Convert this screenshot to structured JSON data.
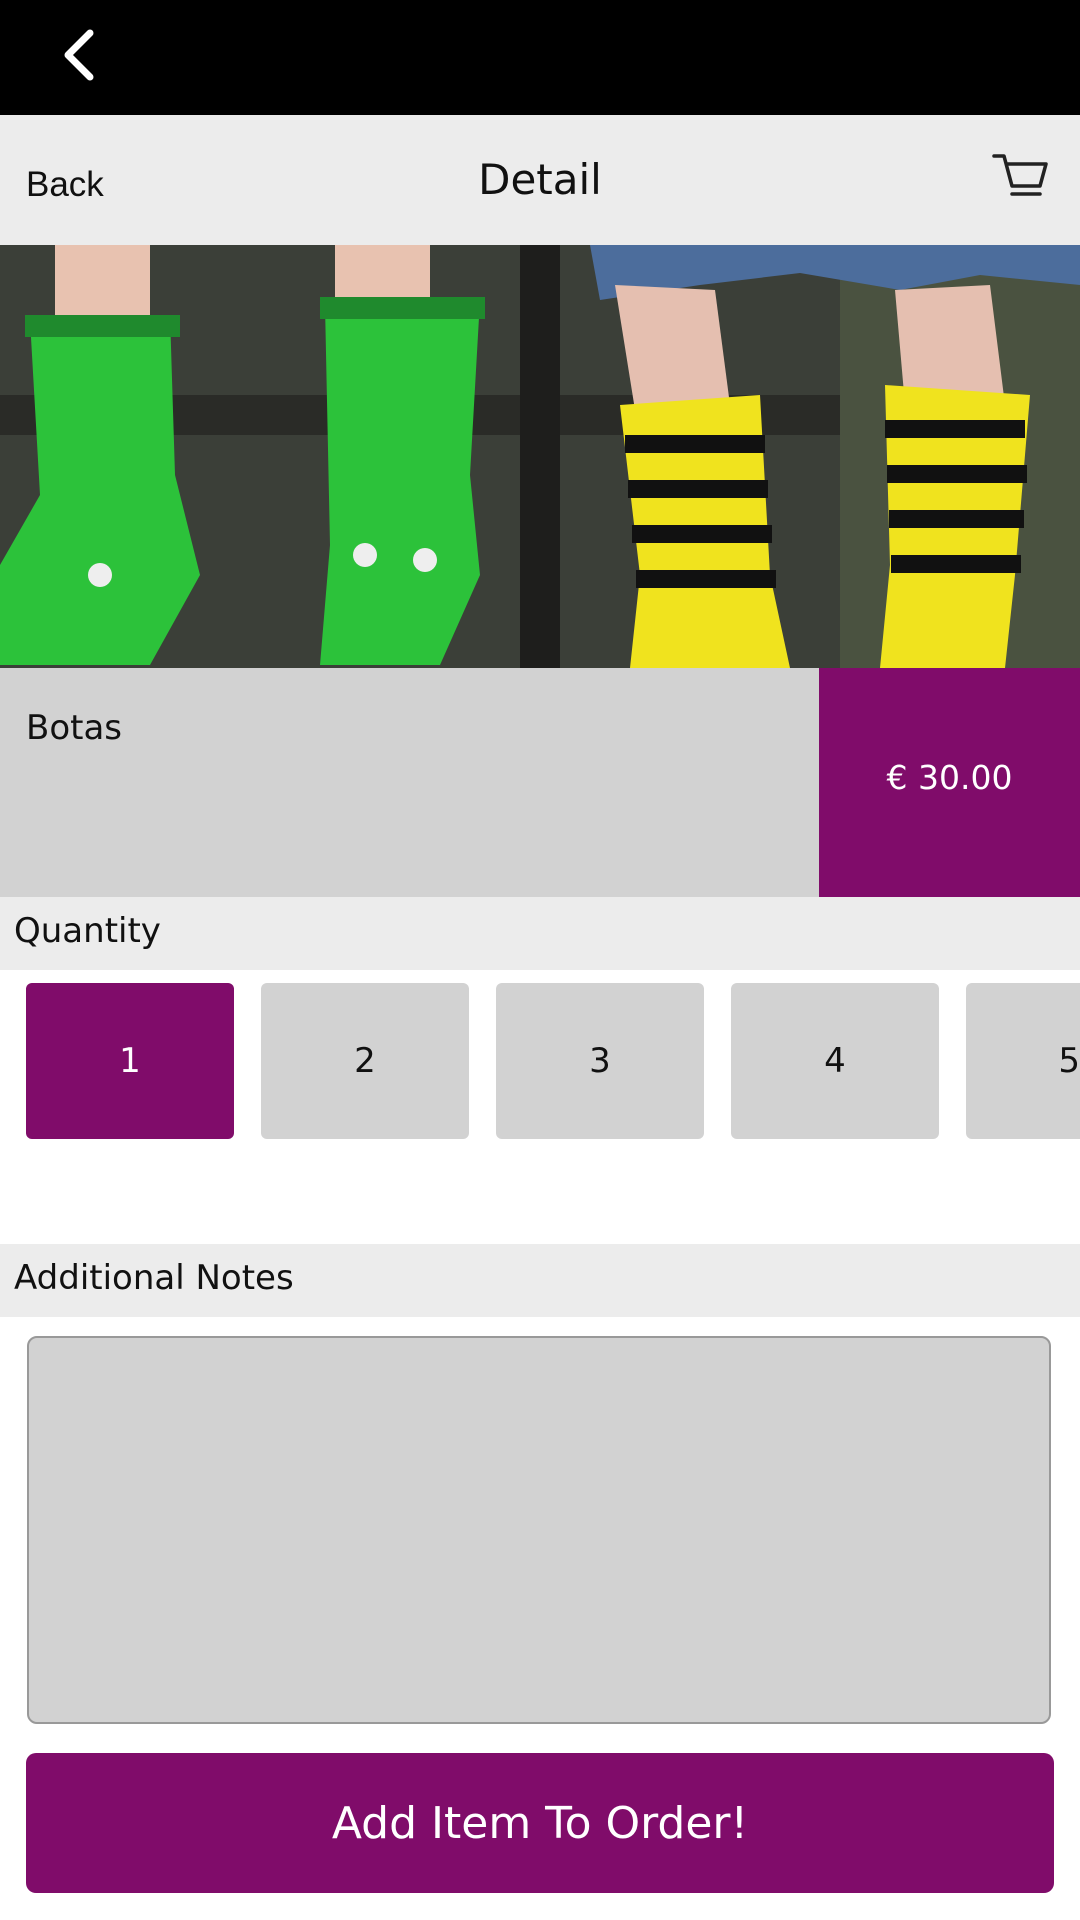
{
  "nav": {
    "back_label": "Back",
    "title": "Detail"
  },
  "product": {
    "name": "Botas",
    "price": "€ 30.00"
  },
  "quantity": {
    "label": "Quantity",
    "options": [
      "1",
      "2",
      "3",
      "4",
      "5"
    ],
    "selected": "1"
  },
  "notes": {
    "label": "Additional Notes",
    "value": ""
  },
  "actions": {
    "add_label": "Add Item To Order!"
  },
  "colors": {
    "accent": "#800c6a",
    "panel": "#d2d2d2",
    "section": "#ececec"
  },
  "icons": {
    "top_back": "chevron-left-icon",
    "cart": "cart-icon"
  }
}
